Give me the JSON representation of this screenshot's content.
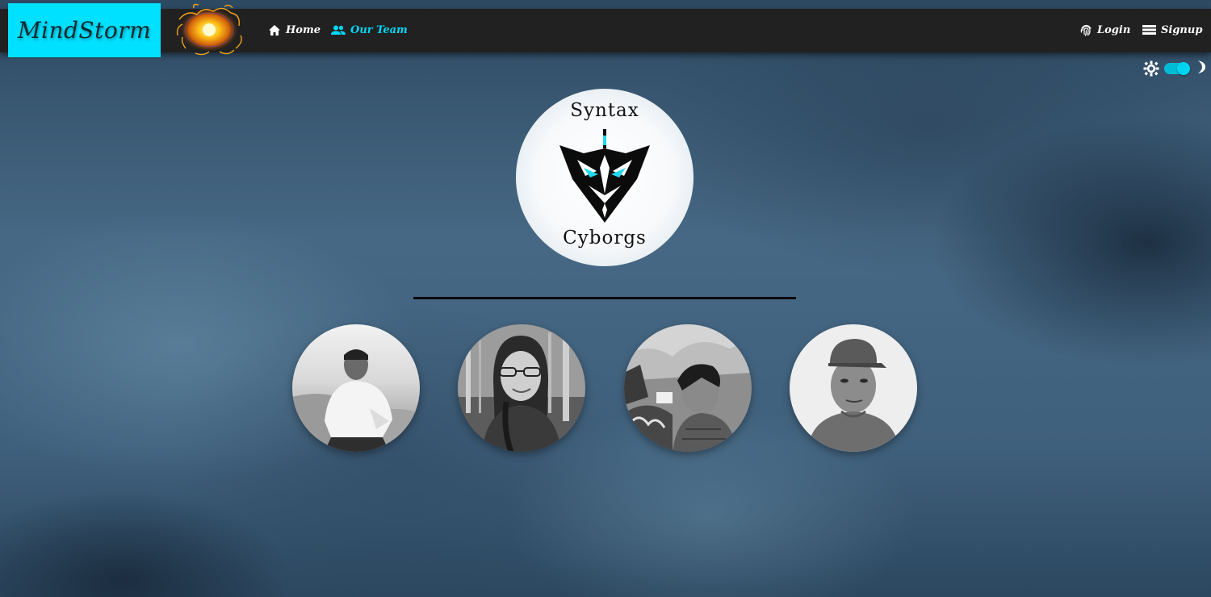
{
  "brand": {
    "name": "MindStorm"
  },
  "nav": {
    "home_label": "Home",
    "team_label": "Our Team",
    "login_label": "Login",
    "signup_label": "Signup",
    "active": "Our Team"
  },
  "icons": {
    "home": "home-icon",
    "team": "people-icon",
    "login": "fingerprint-icon",
    "signup": "list-icon",
    "light": "sun-icon",
    "dark": "moon-icon"
  },
  "theme": {
    "dark_mode_on": true
  },
  "team_logo": {
    "top_text": "Syntax",
    "bottom_text": "Cyborgs"
  },
  "members_count": 4,
  "colors": {
    "accent": "#00e1ff",
    "navbar": "#212121",
    "active_link": "#00d8f5",
    "divider": "#0a0a0a"
  }
}
